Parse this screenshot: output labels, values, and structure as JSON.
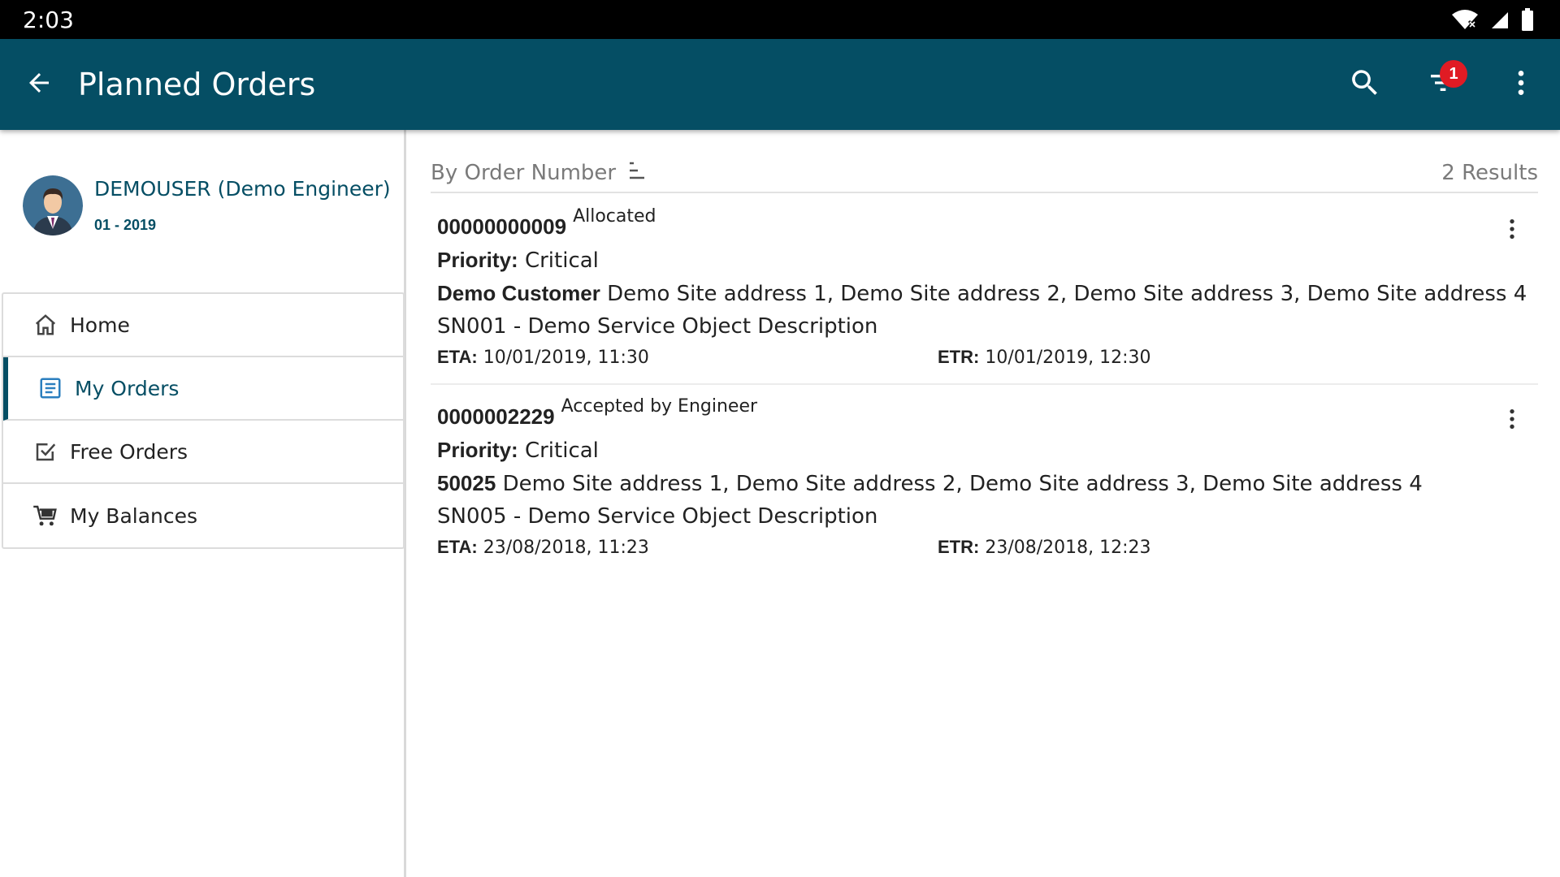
{
  "status_bar": {
    "time": "2:03"
  },
  "app_bar": {
    "title": "Planned Orders",
    "filter_badge_count": "1",
    "color": "#054E64"
  },
  "profile": {
    "name": "DEMOUSER (Demo Engineer)",
    "period": "01 - 2019"
  },
  "nav": {
    "items": [
      {
        "label": "Home",
        "icon": "home-icon"
      },
      {
        "label": "My Orders",
        "icon": "orders-list-icon",
        "active": true
      },
      {
        "label": "Free Orders",
        "icon": "checkbox-icon"
      },
      {
        "label": "My Balances",
        "icon": "cart-icon"
      }
    ]
  },
  "list": {
    "sort_label": "By Order Number",
    "results": "2 Results"
  },
  "orders": [
    {
      "number": "00000000009",
      "status": "Allocated",
      "priority_label": "Priority:",
      "priority": "Critical",
      "customer": "Demo Customer",
      "address": "Demo Site address 1, Demo Site address 2, Demo Site address 3, Demo Site address 4",
      "service_object": "SN001 - Demo Service Object Description",
      "eta_label": "ETA:",
      "eta": "10/01/2019, 11:30",
      "etr_label": "ETR:",
      "etr": "10/01/2019, 12:30"
    },
    {
      "number": "0000002229",
      "status": "Accepted by Engineer",
      "priority_label": "Priority:",
      "priority": "Critical",
      "customer": "50025",
      "address": "Demo Site address 1, Demo Site address 2, Demo Site address 3, Demo Site address 4",
      "service_object": "SN005 - Demo Service Object Description",
      "eta_label": "ETA:",
      "eta": "23/08/2018, 11:23",
      "etr_label": "ETR:",
      "etr": "23/08/2018, 12:23"
    }
  ]
}
